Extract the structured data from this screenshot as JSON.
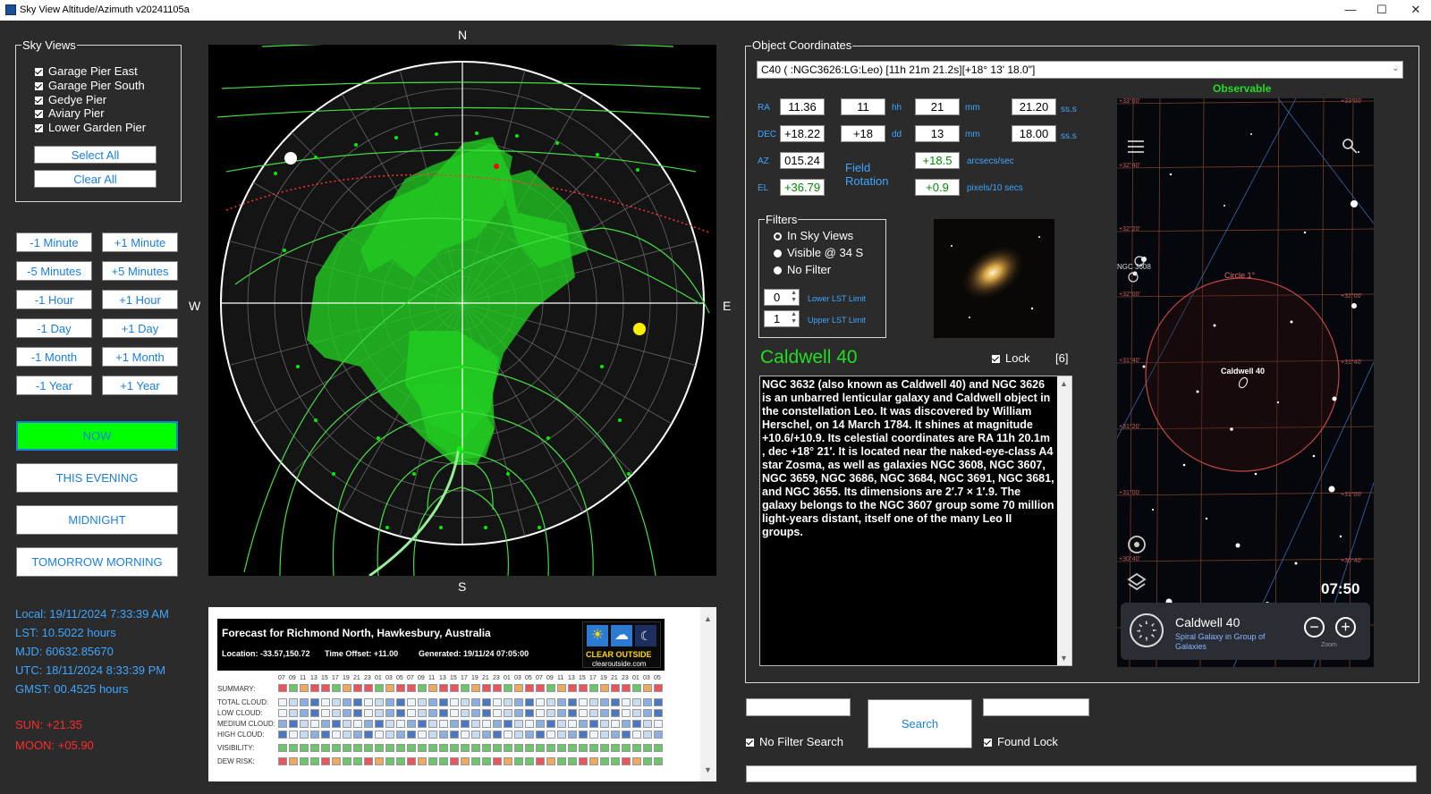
{
  "window": {
    "title": "Sky View Altitude/Azimuth v20241105a"
  },
  "sky_views": {
    "group_title": "Sky Views",
    "items": [
      "Garage Pier East",
      "Garage Pier South",
      "Gedye Pier",
      "Aviary Pier",
      "Lower Garden Pier"
    ],
    "select_all": "Select All",
    "clear_all": "Clear All"
  },
  "time_buttons": {
    "minus_minute": "-1 Minute",
    "plus_minute": "+1 Minute",
    "minus_5min": "-5 Minutes",
    "plus_5min": "+5 Minutes",
    "minus_hour": "-1 Hour",
    "plus_hour": "+1 Hour",
    "minus_day": "-1 Day",
    "plus_day": "+1 Day",
    "minus_month": "-1 Month",
    "plus_month": "+1 Month",
    "minus_year": "-1 Year",
    "plus_year": "+1 Year",
    "now": "NOW",
    "this_evening": "THIS EVENING",
    "midnight": "MIDNIGHT",
    "tomorrow_morning": "TOMORROW MORNING"
  },
  "time_info": {
    "local": "Local:  19/11/2024 7:33:39 AM",
    "lst": "LST:   10.5022 hours",
    "mjd": "MJD:   60632.85670",
    "utc": "UTC:   18/11/2024 8:33:39 PM",
    "gmst": "GMST:  00.4525 hours",
    "sun": "SUN: +21.35",
    "moon": "MOON: +05.90"
  },
  "compass": {
    "n": "N",
    "s": "S",
    "e": "E",
    "w": "W"
  },
  "forecast": {
    "title": "Forecast for Richmond North, Hawkesbury, Australia",
    "location": "Location: -33.57,150.72",
    "offset": "Time Offset: +11.00",
    "generated": "Generated: 19/11/24 07:05:00",
    "brand1": "CLEAR OUTSIDE",
    "brand2": "clearoutside.com",
    "hours": [
      "07",
      "09",
      "11",
      "13",
      "15",
      "17",
      "19",
      "21",
      "23",
      "01",
      "03",
      "05",
      "07",
      "09",
      "11",
      "13",
      "15",
      "17",
      "19",
      "21",
      "23",
      "01",
      "03",
      "05",
      "07",
      "09",
      "11",
      "13",
      "15",
      "17",
      "19",
      "21",
      "23",
      "01",
      "03",
      "05"
    ],
    "rows": [
      "SUMMARY:",
      "TOTAL CLOUD:",
      "LOW CLOUD:",
      "MEDIUM CLOUD:",
      "HIGH CLOUD:",
      "VISIBILITY:",
      "DEW RISK:"
    ]
  },
  "object": {
    "group_title": "Object Coordinates",
    "selected": "C40 ( :NGC3626:LG:Leo) [11h 21m 21.2s][+18° 13' 18.0\"]",
    "ra_label": "RA",
    "ra": "11.36",
    "ra_h": "11",
    "hh": "hh",
    "ra_m": "21",
    "mm": "mm",
    "ra_s": "21.20",
    "ss": "ss.s",
    "dec_label": "DEC",
    "dec": "+18.22",
    "dec_d": "+18",
    "dd": "dd",
    "dec_m": "13",
    "dec_s": "18.00",
    "az_label": "AZ",
    "az": "015.24",
    "el_label": "EL",
    "el": "+36.79",
    "field_rotation": "Field Rotation",
    "rot_rate": "+18.5",
    "rot_rate_unit": "arcsecs/sec",
    "rot_px": "+0.9",
    "rot_px_unit": "pixels/10 secs",
    "filters_title": "Filters",
    "filter_options": [
      "In Sky Views",
      "Visible @ 34 S",
      "No Filter"
    ],
    "lower_lst": "0",
    "lower_lst_label": "Lower LST Limit",
    "upper_lst": "1",
    "upper_lst_label": "Upper LST Limit",
    "name": "Caldwell 40",
    "lock": "Lock",
    "count": "[6]",
    "description": "NGC 3632 (also known as Caldwell 40) and NGC 3626 is an unbarred lenticular galaxy and Caldwell object in the constellation Leo. It was discovered by William Herschel, on 14 March 1784. It shines at magnitude +10.6/+10.9. Its celestial coordinates are RA 11h 20.1m , dec +18° 21′. It is located near the naked-eye-class A4 star Zosma, as well as galaxies NGC 3608, NGC 3607, NGC 3659, NGC 3686, NGC 3684, NGC 3691, NGC 3681, and NGC 3655. Its dimensions are 2′.7 × 1′.9. The galaxy belongs to the NGC 3607 group some 70 million light-years distant, itself one of the many Leo II groups."
  },
  "star_chart": {
    "status": "Observable",
    "grid_labels_left": [
      "+33°00'",
      "+32°40'",
      "+32°20'",
      "+32°00'",
      "+31°40'",
      "+31°20'",
      "+31°00'",
      "+30°40'"
    ],
    "grid_labels_right": [
      "+33°00'",
      "+32°00'",
      "+31°40'",
      "+31°00'",
      "+30°40'"
    ],
    "circle_label": "Circle 1°",
    "ngc_label": "NGC 3608",
    "target_label": "Caldwell 40",
    "time": "07:50",
    "card_title": "Caldwell 40",
    "card_sub": "Spiral Galaxy in Group of Galaxies",
    "zoom_label": "Zoom"
  },
  "search": {
    "button": "Search",
    "no_filter": "No Filter Search",
    "found_lock": "Found Lock"
  }
}
